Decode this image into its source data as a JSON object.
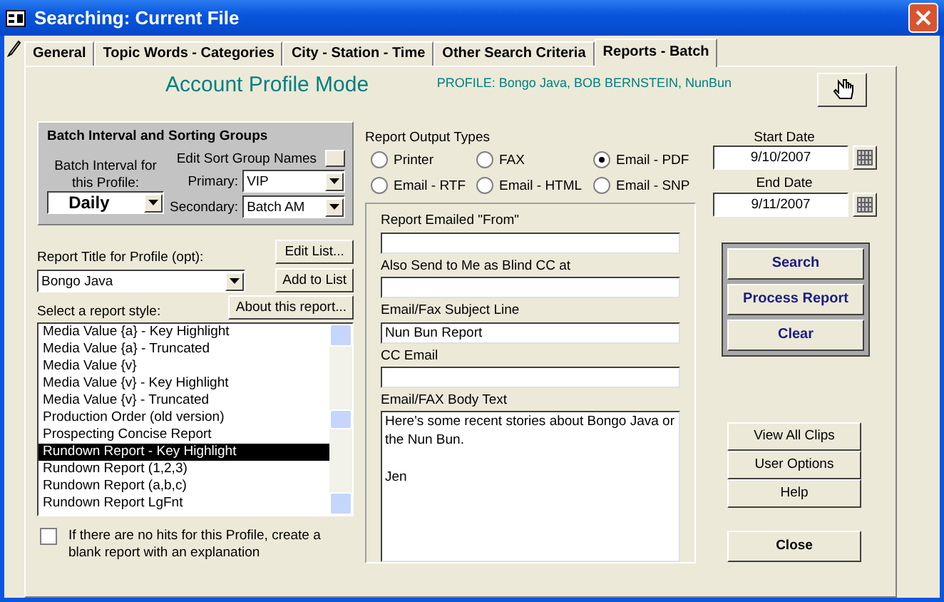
{
  "window": {
    "title": "Searching: Current File"
  },
  "tabs": [
    {
      "label": "General",
      "selected": false
    },
    {
      "label": "Topic Words -  Categories",
      "selected": false
    },
    {
      "label": "City - Station - Time",
      "selected": false
    },
    {
      "label": "Other Search Criteria",
      "selected": false
    },
    {
      "label": "Reports - Batch",
      "selected": true
    }
  ],
  "mode_title": "Account Profile Mode",
  "profile": "PROFILE:  Bongo Java, BOB BERNSTEIN, NunBun",
  "batch_group": {
    "title": "Batch Interval and Sorting Groups",
    "interval_label": "Batch Interval for this Profile:",
    "interval": "Daily",
    "edit_sort_label": "Edit Sort Group Names",
    "primary_label": "Primary:",
    "primary": "VIP",
    "secondary_label": "Secondary:",
    "secondary": "Batch AM"
  },
  "report_title": {
    "label": "Report Title for Profile (opt):",
    "value": "Bongo Java"
  },
  "edit_list_button": "Edit List...",
  "add_to_list_button": "Add to List",
  "style_label": "Select a report style:",
  "about_button": "About this report...",
  "report_styles": [
    {
      "label": "Media Value {a} - Key Highlight",
      "selected": false
    },
    {
      "label": "Media Value {a} - Truncated",
      "selected": false
    },
    {
      "label": "Media Value {v}",
      "selected": false
    },
    {
      "label": "Media Value {v} - Key Highlight",
      "selected": false
    },
    {
      "label": "Media Value {v} - Truncated",
      "selected": false
    },
    {
      "label": "Production Order (old version)",
      "selected": false
    },
    {
      "label": "Prospecting Concise Report",
      "selected": false
    },
    {
      "label": "Rundown Report - Key Highlight",
      "selected": true
    },
    {
      "label": "Rundown Report (1,2,3)",
      "selected": false
    },
    {
      "label": "Rundown Report (a,b,c)",
      "selected": false
    },
    {
      "label": "Rundown Report LgFnt",
      "selected": false
    }
  ],
  "blank_report": {
    "label": "If there are no hits for this Profile, create a blank report with an explanation",
    "checked": false
  },
  "output_types": {
    "label": "Report Output Types",
    "options": [
      {
        "label": "Printer",
        "selected": false
      },
      {
        "label": "FAX",
        "selected": false
      },
      {
        "label": "Email - PDF",
        "selected": true
      },
      {
        "label": "Email - RTF",
        "selected": false
      },
      {
        "label": "Email - HTML",
        "selected": false
      },
      {
        "label": "Email - SNP",
        "selected": false
      }
    ]
  },
  "email_fields": [
    {
      "kind": "line",
      "label": "Report Emailed  \"From\""
    },
    {
      "kind": "line",
      "label": "Also Send to Me as Blind CC at"
    },
    {
      "kind": "line",
      "label": "Email/Fax Subject Line",
      "value": "Nun Bun Report"
    },
    {
      "kind": "line",
      "label": "CC Email"
    },
    {
      "kind": "multiline",
      "label": "Email/FAX Body Text",
      "value": "Here's some recent stories about Bongo Java or the Nun Bun.\n\nJen"
    }
  ],
  "start_date": {
    "label": "Start Date",
    "value": "9/10/2007"
  },
  "end_date": {
    "label": "End Date",
    "value": "9/11/2007"
  },
  "action_buttons": [
    "Search",
    "Process Report",
    "Clear"
  ],
  "side_buttons": [
    "View All Clips",
    "User Options",
    "Help"
  ],
  "close_button": "Close"
}
